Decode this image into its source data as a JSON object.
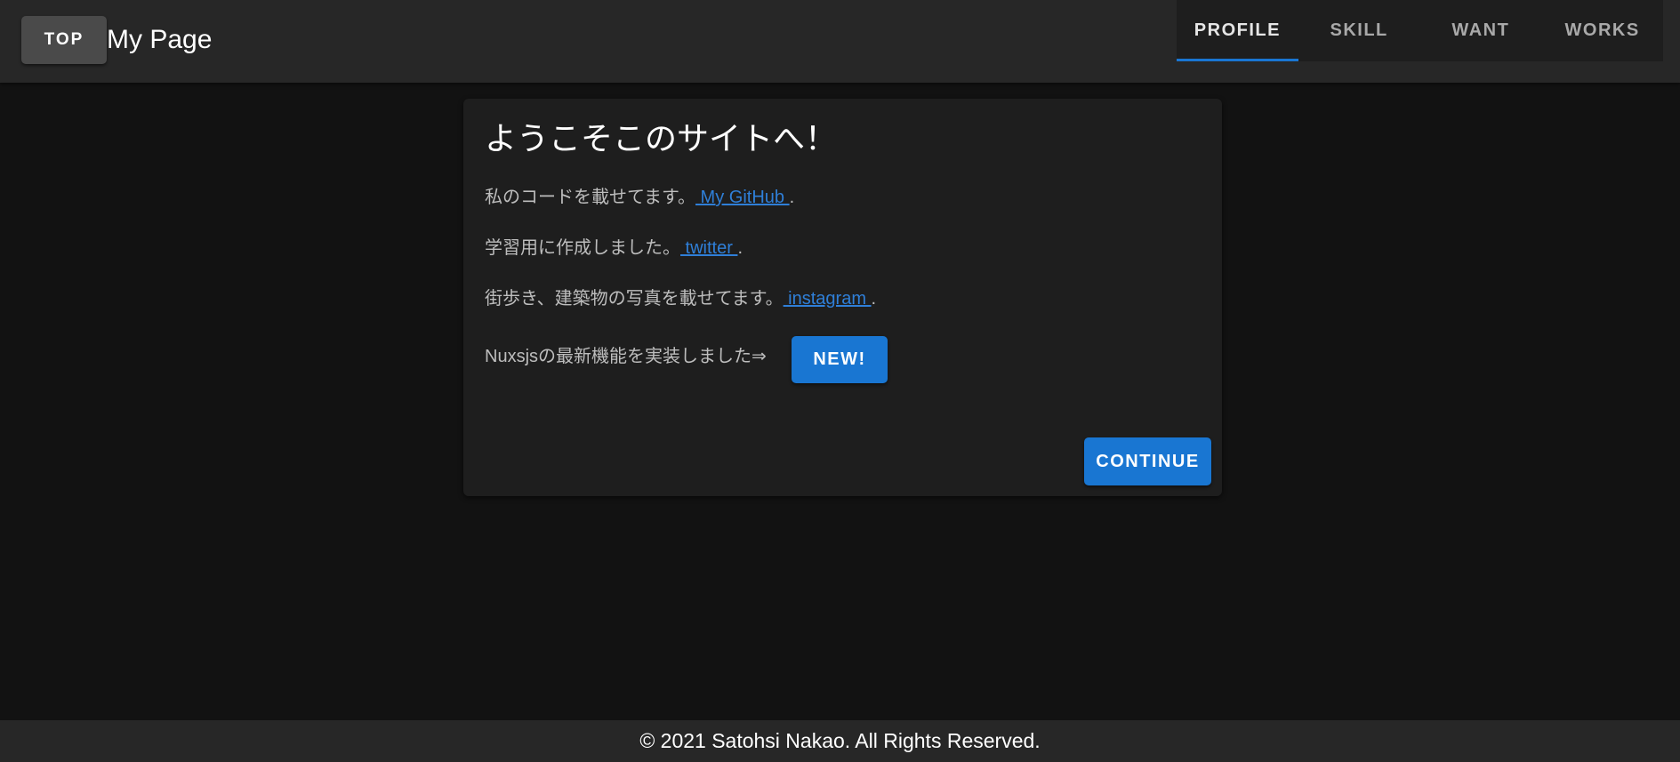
{
  "header": {
    "top_button_label": "TOP",
    "title": "My Page",
    "tabs": [
      {
        "label": "PROFILE",
        "active": true
      },
      {
        "label": "SKILL",
        "active": false
      },
      {
        "label": "WANT",
        "active": false
      },
      {
        "label": "WORKS",
        "active": false
      }
    ]
  },
  "card": {
    "title": "ようこそこのサイトへ！",
    "lines": [
      {
        "text": "私のコードを載せてます。",
        "link": " My GitHub ",
        "suffix": "."
      },
      {
        "text": "学習用に作成しました。",
        "link": " twitter ",
        "suffix": "."
      },
      {
        "text": "街歩き、建築物の写真を載せてます。",
        "link": " instagram ",
        "suffix": "."
      }
    ],
    "new_line_text": "Nuxsjsの最新機能を実装しました⇒",
    "new_button_label": "NEW!",
    "continue_button_label": "CONTINUE"
  },
  "footer": {
    "text": "© 2021 Satohsi Nakao. All Rights Reserved."
  },
  "colors": {
    "accent": "#1976d2",
    "link": "#2f7fd8",
    "background": "#121212",
    "surface": "#1e1e1e",
    "app_bar": "#272727"
  }
}
